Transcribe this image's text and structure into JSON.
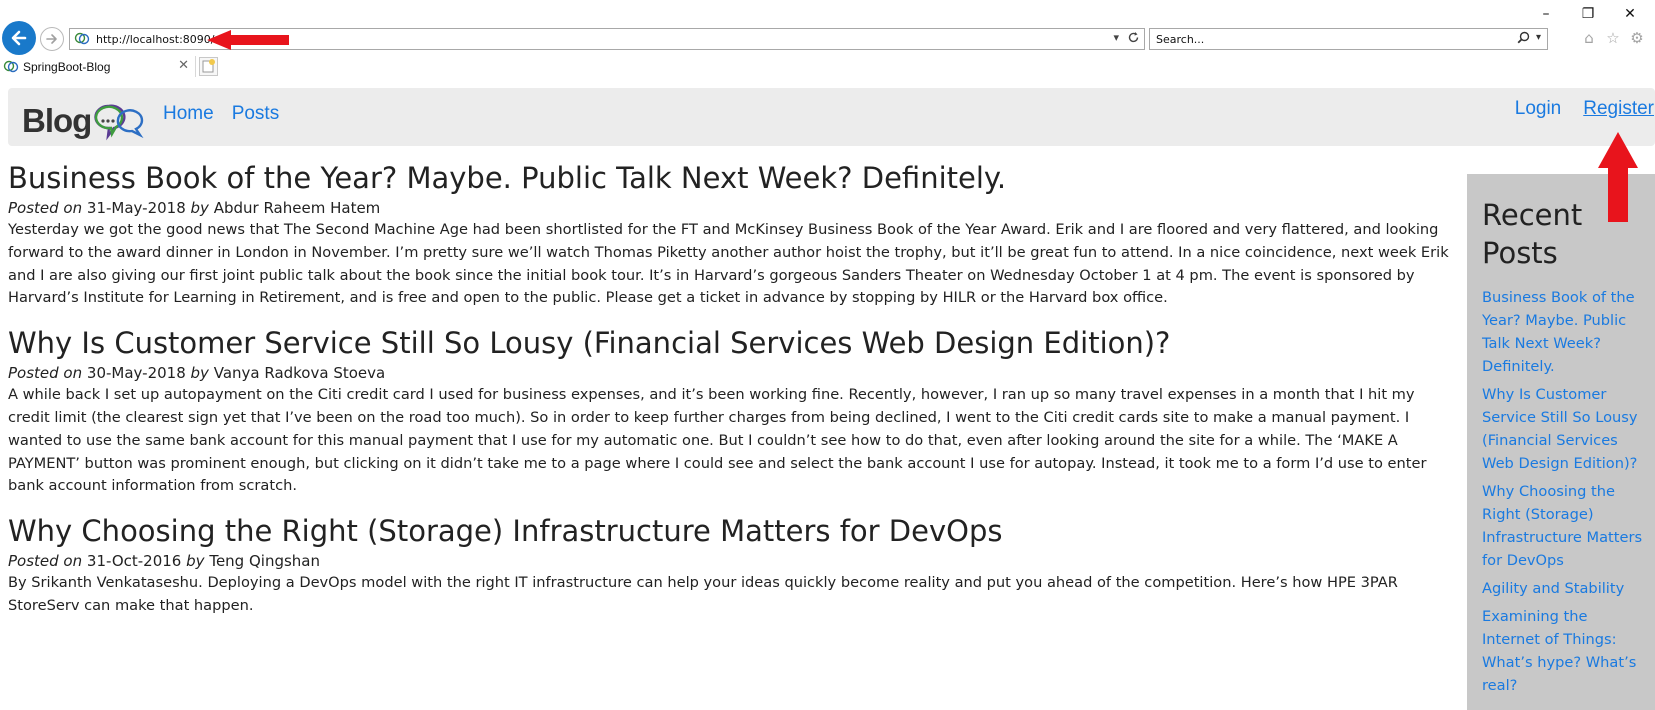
{
  "browser": {
    "address_url": "http://localhost:8090/",
    "search_placeholder": "Search...",
    "tab_title": "SpringBoot-Blog",
    "window_minimize": "–",
    "window_restore": "❐",
    "window_close": "✕"
  },
  "navbar": {
    "brand_text": "Blog",
    "links_left": [
      "Home",
      "Posts"
    ],
    "links_right": [
      "Login",
      "Register"
    ]
  },
  "posts": [
    {
      "title": "Business Book of the Year? Maybe. Public Talk Next Week? Definitely.",
      "posted_on_label": "Posted on",
      "date": "31-May-2018",
      "by_label": "by",
      "author": "Abdur Raheem Hatem",
      "body": "Yesterday we got the good news that The Second Machine Age had been shortlisted for the FT and McKinsey Business Book of the Year Award. Erik and I are floored and very flattered, and looking forward to the award dinner in London in November. I’m pretty sure we’ll watch Thomas Piketty another author hoist the trophy, but it’ll be great fun to attend. In a nice coincidence, next week Erik and I are also giving our first joint public talk about the book since the initial book tour. It’s in Harvard’s gorgeous Sanders Theater on Wednesday October 1 at 4 pm. The event is sponsored by Harvard’s Institute for Learning in Retirement, and is free and open to the public. Please get a ticket in advance by stopping by HILR or the Harvard box office."
    },
    {
      "title": "Why Is Customer Service Still So Lousy (Financial Services Web Design Edition)?",
      "posted_on_label": "Posted on",
      "date": "30-May-2018",
      "by_label": "by",
      "author": "Vanya Radkova Stoeva",
      "body": "A while back I set up autopayment on the Citi credit card I used for business expenses, and it’s been working fine. Recently, however, I ran up so many travel expenses in a month that I hit my credit limit (the clearest sign yet that I’ve been on the road too much). So in order to keep further charges from being declined, I went to the Citi credit cards site to make a manual payment. I wanted to use the same bank account for this manual payment that I use for my automatic one. But I couldn’t see how to do that, even after looking around the site for a while. The ‘MAKE A PAYMENT’ button was prominent enough, but clicking on it didn’t take me to a page where I could see and select the bank account I use for autopay. Instead, it took me to a form I’d use to enter bank account information from scratch."
    },
    {
      "title": "Why Choosing the Right (Storage) Infrastructure Matters for DevOps",
      "posted_on_label": "Posted on",
      "date": "31-Oct-2016",
      "by_label": "by",
      "author": "Teng Qingshan",
      "body": "By Srikanth Venkataseshu. Deploying a DevOps model with the right IT infrastructure can help your ideas quickly become reality and put you ahead of the competition. Here’s how HPE 3PAR StoreServ can make that happen."
    }
  ],
  "sidebar": {
    "title": "Recent Posts",
    "items": [
      "Business Book of the Year? Maybe. Public Talk Next Week? Definitely.",
      "Why Is Customer Service Still So Lousy (Financial Services Web Design Edition)?",
      "Why Choosing the Right (Storage) Infrastructure Matters for DevOps",
      "Agility and Stability",
      "Examining the Internet of Things: What’s hype? What’s real?"
    ]
  },
  "colors": {
    "link": "#1a7ae0",
    "navbar_bg": "#ececec",
    "sidebar_bg": "#c8c8c8",
    "annotation_arrow": "#e8141c",
    "back_button": "#1979ca"
  },
  "icons": {
    "back": "back-arrow-icon",
    "forward": "forward-arrow-icon",
    "site": "site-favicon-icon",
    "dropdown": "chevron-down-icon",
    "refresh": "refresh-icon",
    "search": "search-icon",
    "home": "home-icon",
    "favorites": "star-icon",
    "settings": "gear-icon",
    "tab_close": "close-icon",
    "new_tab": "new-tab-icon"
  }
}
